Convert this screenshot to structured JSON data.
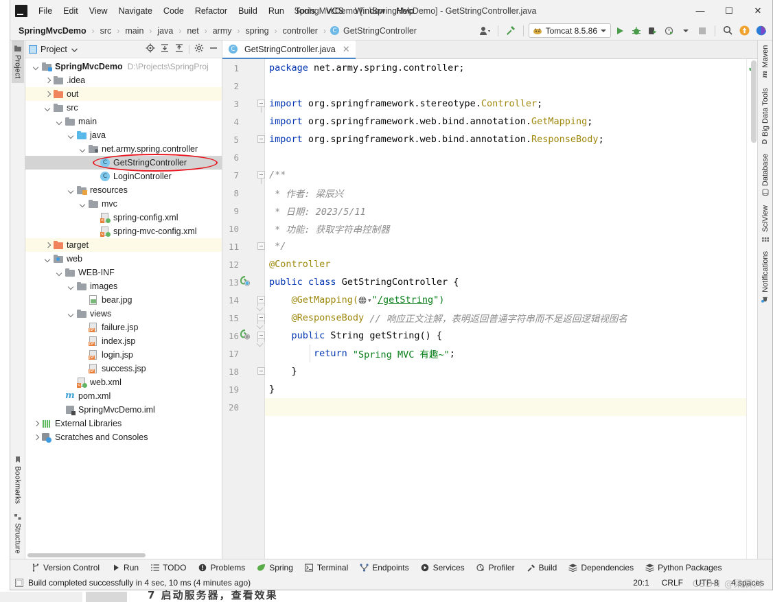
{
  "window": {
    "title": "SpringMvcDemo [...\\SpringMvcDemo] - GetStringController.java",
    "minimize": "—",
    "maximize": "☐",
    "close": "✕",
    "logo": "IJ"
  },
  "menu": {
    "items": [
      "File",
      "Edit",
      "View",
      "Navigate",
      "Code",
      "Refactor",
      "Build",
      "Run",
      "Tools",
      "VCS",
      "Window",
      "Help"
    ]
  },
  "breadcrumb": {
    "project": "SpringMvcDemo",
    "items": [
      "src",
      "main",
      "java",
      "net",
      "army",
      "spring",
      "controller"
    ],
    "file": "GetStringController",
    "file_icon": "C",
    "separator": "›"
  },
  "toolbar": {
    "run_config": "Tomcat 8.5.86",
    "icons": [
      "user-avatar-icon",
      "hammer-build-icon",
      "run-icon",
      "debug-icon",
      "run-with-coverage-icon",
      "profile-icon",
      "stop-icon",
      "search-everywhere-icon",
      "update-icon",
      "ide-feature-icon"
    ]
  },
  "left_strip": {
    "items": [
      {
        "label": "Project",
        "icon": "project-folder-icon",
        "active": true
      },
      {
        "label": "Bookmarks",
        "icon": "bookmark-icon",
        "active": false
      },
      {
        "label": "Structure",
        "icon": "structure-icon",
        "active": false
      }
    ]
  },
  "right_strip": {
    "items": [
      {
        "label": "Maven",
        "icon": "maven-icon"
      },
      {
        "label": "Big Data Tools",
        "icon": "big-data-tools-icon"
      },
      {
        "label": "Database",
        "icon": "database-icon"
      },
      {
        "label": "SciView",
        "icon": "sciview-icon"
      },
      {
        "label": "Notifications",
        "icon": "notifications-icon"
      }
    ]
  },
  "project_panel": {
    "title": "Project",
    "header_icons": [
      "locate-icon",
      "expand-all-icon",
      "collapse-all-icon",
      "settings-gear-icon",
      "hide-icon"
    ],
    "tree": [
      {
        "label": "SpringMvcDemo",
        "hint": "D:\\Projects\\SpringProj",
        "depth": 0,
        "arrow": "down",
        "icon": "module-folder-icon",
        "bold": true,
        "state": "normal"
      },
      {
        "label": ".idea",
        "hint": "",
        "depth": 1,
        "arrow": "right",
        "icon": "folder-grey-icon",
        "bold": false,
        "state": "normal"
      },
      {
        "label": "out",
        "hint": "",
        "depth": 1,
        "arrow": "right",
        "icon": "folder-orange-icon",
        "bold": false,
        "state": "tinted"
      },
      {
        "label": "src",
        "hint": "",
        "depth": 1,
        "arrow": "down",
        "icon": "folder-grey-icon",
        "bold": false,
        "state": "normal"
      },
      {
        "label": "main",
        "hint": "",
        "depth": 2,
        "arrow": "down",
        "icon": "folder-grey-icon",
        "bold": false,
        "state": "normal"
      },
      {
        "label": "java",
        "hint": "",
        "depth": 3,
        "arrow": "down",
        "icon": "folder-source-icon",
        "bold": false,
        "state": "normal"
      },
      {
        "label": "net.army.spring.controller",
        "hint": "",
        "depth": 4,
        "arrow": "down",
        "icon": "package-icon",
        "bold": false,
        "state": "normal"
      },
      {
        "label": "GetStringController",
        "hint": "",
        "depth": 5,
        "arrow": "none",
        "icon": "java-class-icon",
        "bold": false,
        "state": "selected"
      },
      {
        "label": "LoginController",
        "hint": "",
        "depth": 5,
        "arrow": "none",
        "icon": "java-class-icon",
        "bold": false,
        "state": "normal"
      },
      {
        "label": "resources",
        "hint": "",
        "depth": 3,
        "arrow": "down",
        "icon": "folder-resources-icon",
        "bold": false,
        "state": "normal"
      },
      {
        "label": "mvc",
        "hint": "",
        "depth": 4,
        "arrow": "down",
        "icon": "folder-grey-icon",
        "bold": false,
        "state": "normal"
      },
      {
        "label": "spring-config.xml",
        "hint": "",
        "depth": 5,
        "arrow": "none",
        "icon": "xml-spring-icon",
        "bold": false,
        "state": "normal"
      },
      {
        "label": "spring-mvc-config.xml",
        "hint": "",
        "depth": 5,
        "arrow": "none",
        "icon": "xml-spring-icon",
        "bold": false,
        "state": "normal"
      },
      {
        "label": "target",
        "hint": "",
        "depth": 1,
        "arrow": "right",
        "icon": "folder-orange-icon",
        "bold": false,
        "state": "tinted"
      },
      {
        "label": "web",
        "hint": "",
        "depth": 1,
        "arrow": "down",
        "icon": "folder-web-icon",
        "bold": false,
        "state": "normal"
      },
      {
        "label": "WEB-INF",
        "hint": "",
        "depth": 2,
        "arrow": "down",
        "icon": "folder-grey-icon",
        "bold": false,
        "state": "normal"
      },
      {
        "label": "images",
        "hint": "",
        "depth": 3,
        "arrow": "down",
        "icon": "folder-grey-icon",
        "bold": false,
        "state": "normal"
      },
      {
        "label": "bear.jpg",
        "hint": "",
        "depth": 4,
        "arrow": "none",
        "icon": "image-file-icon",
        "bold": false,
        "state": "normal"
      },
      {
        "label": "views",
        "hint": "",
        "depth": 3,
        "arrow": "down",
        "icon": "folder-grey-icon",
        "bold": false,
        "state": "normal"
      },
      {
        "label": "failure.jsp",
        "hint": "",
        "depth": 4,
        "arrow": "none",
        "icon": "jsp-file-icon",
        "bold": false,
        "state": "normal"
      },
      {
        "label": "index.jsp",
        "hint": "",
        "depth": 4,
        "arrow": "none",
        "icon": "jsp-file-icon",
        "bold": false,
        "state": "normal"
      },
      {
        "label": "login.jsp",
        "hint": "",
        "depth": 4,
        "arrow": "none",
        "icon": "jsp-file-icon",
        "bold": false,
        "state": "normal"
      },
      {
        "label": "success.jsp",
        "hint": "",
        "depth": 4,
        "arrow": "none",
        "icon": "jsp-file-icon",
        "bold": false,
        "state": "normal"
      },
      {
        "label": "web.xml",
        "hint": "",
        "depth": 3,
        "arrow": "none",
        "icon": "xml-spring-icon",
        "bold": false,
        "state": "normal"
      },
      {
        "label": "pom.xml",
        "hint": "",
        "depth": 2,
        "arrow": "none",
        "icon": "maven-pom-icon",
        "bold": false,
        "state": "normal"
      },
      {
        "label": "SpringMvcDemo.iml",
        "hint": "",
        "depth": 2,
        "arrow": "none",
        "icon": "iml-file-icon",
        "bold": false,
        "state": "normal"
      },
      {
        "label": "External Libraries",
        "hint": "",
        "depth": 0,
        "arrow": "right",
        "icon": "libraries-icon",
        "bold": false,
        "state": "normal"
      },
      {
        "label": "Scratches and Consoles",
        "hint": "",
        "depth": 0,
        "arrow": "right",
        "icon": "scratches-icon",
        "bold": false,
        "state": "normal"
      }
    ]
  },
  "editor": {
    "tab": {
      "label": "GetStringController.java",
      "icon": "java-class-icon",
      "close": "✕"
    },
    "inspection_status": "✔",
    "lines": [
      {
        "n": "1",
        "gutter_icon": "",
        "fold": "",
        "tokens": [
          {
            "t": "package ",
            "c": "kw"
          },
          {
            "t": "net.army.spring.controller;",
            "c": "plain"
          }
        ]
      },
      {
        "n": "2",
        "gutter_icon": "",
        "fold": "",
        "tokens": []
      },
      {
        "n": "3",
        "gutter_icon": "",
        "fold": "fold-start",
        "tokens": [
          {
            "t": "import ",
            "c": "kw"
          },
          {
            "t": "org.springframework.stereotype.",
            "c": "plain"
          },
          {
            "t": "Controller",
            "c": "cls"
          },
          {
            "t": ";",
            "c": "plain"
          }
        ]
      },
      {
        "n": "4",
        "gutter_icon": "",
        "fold": "",
        "tokens": [
          {
            "t": "import ",
            "c": "kw"
          },
          {
            "t": "org.springframework.web.bind.annotation.",
            "c": "plain"
          },
          {
            "t": "GetMapping",
            "c": "cls"
          },
          {
            "t": ";",
            "c": "plain"
          }
        ]
      },
      {
        "n": "5",
        "gutter_icon": "",
        "fold": "fold-end",
        "tokens": [
          {
            "t": "import ",
            "c": "kw"
          },
          {
            "t": "org.springframework.web.bind.annotation.",
            "c": "plain"
          },
          {
            "t": "ResponseBody",
            "c": "cls"
          },
          {
            "t": ";",
            "c": "plain"
          }
        ]
      },
      {
        "n": "6",
        "gutter_icon": "",
        "fold": "",
        "tokens": []
      },
      {
        "n": "7",
        "gutter_icon": "",
        "fold": "fold-start",
        "tokens": [
          {
            "t": "/**",
            "c": "cmt"
          }
        ]
      },
      {
        "n": "8",
        "gutter_icon": "",
        "fold": "",
        "tokens": [
          {
            "t": " * 作者: 梁辰兴",
            "c": "cmt"
          }
        ]
      },
      {
        "n": "9",
        "gutter_icon": "",
        "fold": "",
        "tokens": [
          {
            "t": " * 日期: 2023/5/11",
            "c": "cmt"
          }
        ]
      },
      {
        "n": "10",
        "gutter_icon": "",
        "fold": "",
        "tokens": [
          {
            "t": " * 功能: 获取字符串控制器",
            "c": "cmt"
          }
        ]
      },
      {
        "n": "11",
        "gutter_icon": "",
        "fold": "fold-end",
        "tokens": [
          {
            "t": " */",
            "c": "cmt"
          }
        ]
      },
      {
        "n": "12",
        "gutter_icon": "",
        "fold": "",
        "tokens": [
          {
            "t": "@Controller",
            "c": "ann"
          }
        ]
      },
      {
        "n": "13",
        "gutter_icon": "spring-bean-icon",
        "fold": "",
        "tokens": [
          {
            "t": "public ",
            "c": "kw"
          },
          {
            "t": "class ",
            "c": "kw"
          },
          {
            "t": "GetStringController {",
            "c": "plain"
          }
        ]
      },
      {
        "n": "14",
        "gutter_icon": "",
        "fold": "fold-mid",
        "tokens": [
          {
            "t": "    @GetMapping(",
            "c": "ann"
          },
          {
            "t": "GLOBE",
            "c": "globe"
          },
          {
            "t": "\"",
            "c": "str"
          },
          {
            "t": "/getString",
            "c": "url"
          },
          {
            "t": "\")",
            "c": "str"
          }
        ]
      },
      {
        "n": "15",
        "gutter_icon": "",
        "fold": "fold-mid",
        "tokens": [
          {
            "t": "    @ResponseBody ",
            "c": "ann"
          },
          {
            "t": "// 响应正文注解，表明返回普通字符串而不是返回逻辑视图名",
            "c": "cmt"
          }
        ]
      },
      {
        "n": "16",
        "gutter_icon": "spring-url-icon",
        "fold": "fold-mid",
        "tokens": [
          {
            "t": "    public ",
            "c": "kw"
          },
          {
            "t": "String ",
            "c": "plain"
          },
          {
            "t": "getString",
            "c": "plain"
          },
          {
            "t": "() {",
            "c": "plain"
          }
        ]
      },
      {
        "n": "17",
        "gutter_icon": "",
        "fold": "",
        "tokens": [
          {
            "t": "        return ",
            "c": "kw"
          },
          {
            "t": "\"Spring MVC 有趣~\"",
            "c": "str"
          },
          {
            "t": ";",
            "c": "plain"
          }
        ]
      },
      {
        "n": "18",
        "gutter_icon": "",
        "fold": "fold-end",
        "tokens": [
          {
            "t": "    }",
            "c": "plain"
          }
        ]
      },
      {
        "n": "19",
        "gutter_icon": "",
        "fold": "",
        "tokens": [
          {
            "t": "}",
            "c": "plain"
          }
        ]
      },
      {
        "n": "20",
        "gutter_icon": "",
        "fold": "",
        "tokens": [],
        "caret": true
      }
    ]
  },
  "bottom_toolbar": {
    "items": [
      {
        "label": "Version Control",
        "icon": "branch-icon"
      },
      {
        "label": "Run",
        "icon": "run-icon"
      },
      {
        "label": "TODO",
        "icon": "todo-list-icon"
      },
      {
        "label": "Problems",
        "icon": "problems-icon"
      },
      {
        "label": "Spring",
        "icon": "spring-leaf-icon"
      },
      {
        "label": "Terminal",
        "icon": "terminal-icon"
      },
      {
        "label": "Endpoints",
        "icon": "endpoints-icon"
      },
      {
        "label": "Services",
        "icon": "services-icon"
      },
      {
        "label": "Profiler",
        "icon": "profiler-icon"
      },
      {
        "label": "Build",
        "icon": "hammer-build-icon"
      },
      {
        "label": "Dependencies",
        "icon": "dependencies-icon"
      },
      {
        "label": "Python Packages",
        "icon": "python-packages-icon"
      }
    ]
  },
  "statusbar": {
    "message": "Build completed successfully in 4 sec, 10 ms (4 minutes ago)",
    "caret_position": "20:1",
    "line_separator": "CRLF",
    "encoding": "UTF-8",
    "indent": "4 spaces",
    "watermark": "CSDN @梁辰兴"
  },
  "background_page": {
    "text": "7  启动服务器，查看效果"
  },
  "colors": {
    "accent_blue": "#4a86c8",
    "keyword": "#0033b3",
    "string": "#067d17",
    "annotation": "#9e880d",
    "comment": "#8c8c8c",
    "selection": "#d4d4d4",
    "caret_line": "#fcfae8",
    "annotation_ellipse": "#e8161f",
    "status_ok": "#59a869"
  }
}
